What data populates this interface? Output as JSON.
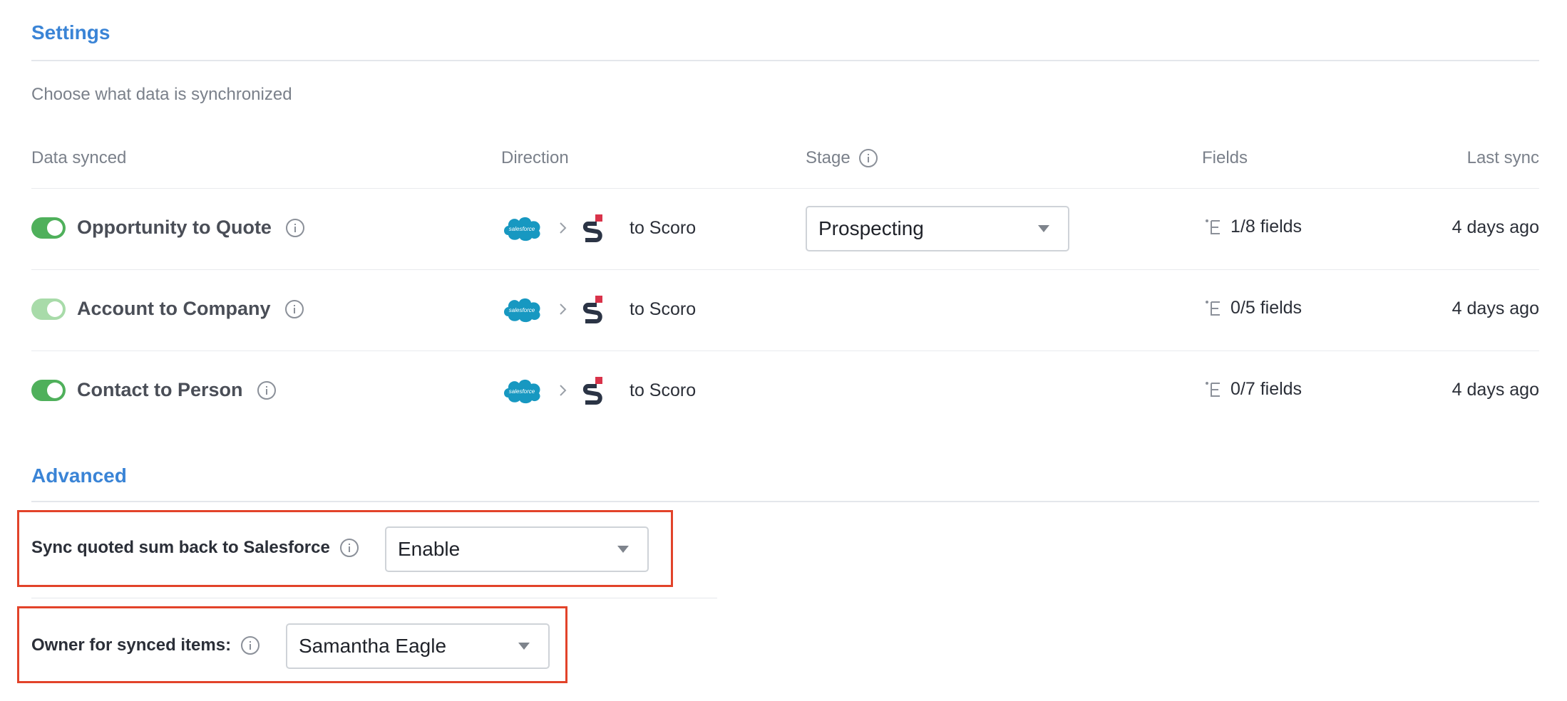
{
  "settings": {
    "title": "Settings",
    "subtitle": "Choose what data is synchronized",
    "columns": {
      "data_synced": "Data synced",
      "direction": "Direction",
      "stage": "Stage",
      "fields": "Fields",
      "last_sync": "Last sync"
    },
    "rows": [
      {
        "label": "Opportunity to Quote",
        "enabled": true,
        "direction": "to Scoro",
        "stage": "Prospecting",
        "fields": "1/8 fields",
        "last_sync": "4 days ago"
      },
      {
        "label": "Account to Company",
        "enabled": true,
        "direction": "to Scoro",
        "stage": "",
        "fields": "0/5 fields",
        "last_sync": "4 days ago"
      },
      {
        "label": "Contact to Person",
        "enabled": true,
        "direction": "to Scoro",
        "stage": "",
        "fields": "0/7 fields",
        "last_sync": "4 days ago"
      }
    ],
    "direction_icons": [
      "salesforce-icon",
      "chevron-right-icon",
      "scoro-icon"
    ],
    "sf_logo_text": "salesforce"
  },
  "advanced": {
    "title": "Advanced",
    "sync_sum": {
      "label": "Sync quoted sum back to Salesforce",
      "value": "Enable"
    },
    "owner": {
      "label": "Owner for synced items:",
      "value": "Samantha Eagle"
    }
  },
  "colors": {
    "accent": "#3a84d6",
    "toggle_on": "#4fb05b",
    "highlight": "#e2432a",
    "salesforce": "#1798c1",
    "scoro_red": "#d9334a",
    "scoro_dark": "#2b3445"
  }
}
